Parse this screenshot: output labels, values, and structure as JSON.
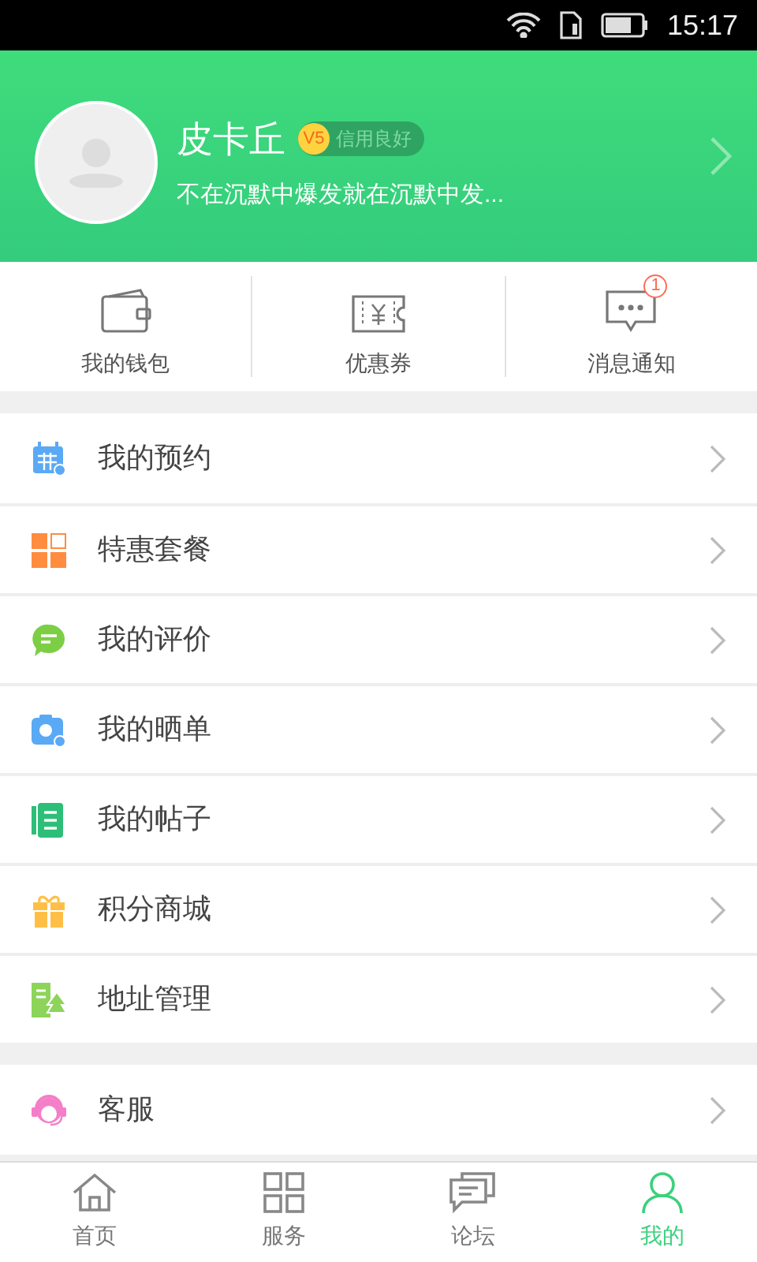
{
  "status_bar": {
    "time": "15:17"
  },
  "profile": {
    "name": "皮卡丘",
    "level_badge": "V5",
    "credit": "信用良好",
    "motto": "不在沉默中爆发就在沉默中发..."
  },
  "shortcuts": [
    {
      "label": "我的钱包"
    },
    {
      "label": "优惠券"
    },
    {
      "label": "消息通知",
      "badge": "1"
    }
  ],
  "menu_groups": [
    [
      {
        "label": "我的预约"
      },
      {
        "label": "特惠套餐"
      },
      {
        "label": "我的评价"
      },
      {
        "label": "我的晒单"
      },
      {
        "label": "我的帖子"
      },
      {
        "label": "积分商城"
      },
      {
        "label": "地址管理"
      }
    ],
    [
      {
        "label": "客服"
      }
    ]
  ],
  "bottom_nav": [
    {
      "label": "首页",
      "selected": false
    },
    {
      "label": "服务",
      "selected": false
    },
    {
      "label": "论坛",
      "selected": false
    },
    {
      "label": "我的",
      "selected": true
    }
  ]
}
